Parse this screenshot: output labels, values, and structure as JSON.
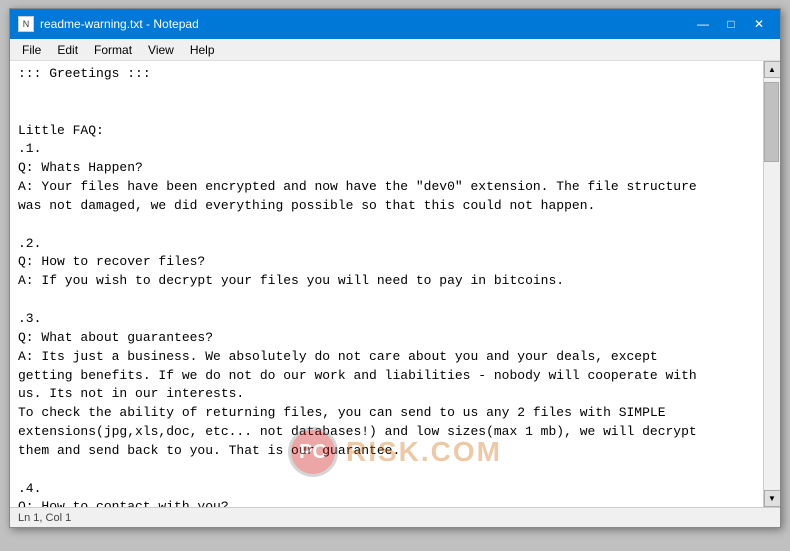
{
  "window": {
    "title": "readme-warning.txt - Notepad",
    "icon_label": "N"
  },
  "title_controls": {
    "minimize": "—",
    "maximize": "□",
    "close": "✕"
  },
  "menu": {
    "items": [
      "File",
      "Edit",
      "Format",
      "View",
      "Help"
    ]
  },
  "content": "::: Greetings :::\n\n\nLittle FAQ:\n.1.\nQ: Whats Happen?\nA: Your files have been encrypted and now have the \"dev0\" extension. The file structure\nwas not damaged, we did everything possible so that this could not happen.\n\n.2.\nQ: How to recover files?\nA: If you wish to decrypt your files you will need to pay in bitcoins.\n\n.3.\nQ: What about guarantees?\nA: Its just a business. We absolutely do not care about you and your deals, except\ngetting benefits. If we do not do our work and liabilities - nobody will cooperate with\nus. Its not in our interests.\nTo check the ability of returning files, you can send to us any 2 files with SIMPLE\nextensions(jpg,xls,doc, etc... not databases!) and low sizes(max 1 mb), we will decrypt\nthem and send back to you. That is our guarantee.\n\n.4.\nQ: How to contact with you?\nA: You can write us to our mailbox: xdatarecovery@msgsafe.io or bobwhite@cock.li",
  "watermark": {
    "logo_text": "PC",
    "text": "RISK.COM"
  },
  "status_bar": {
    "text": "Ln 1, Col 1"
  }
}
